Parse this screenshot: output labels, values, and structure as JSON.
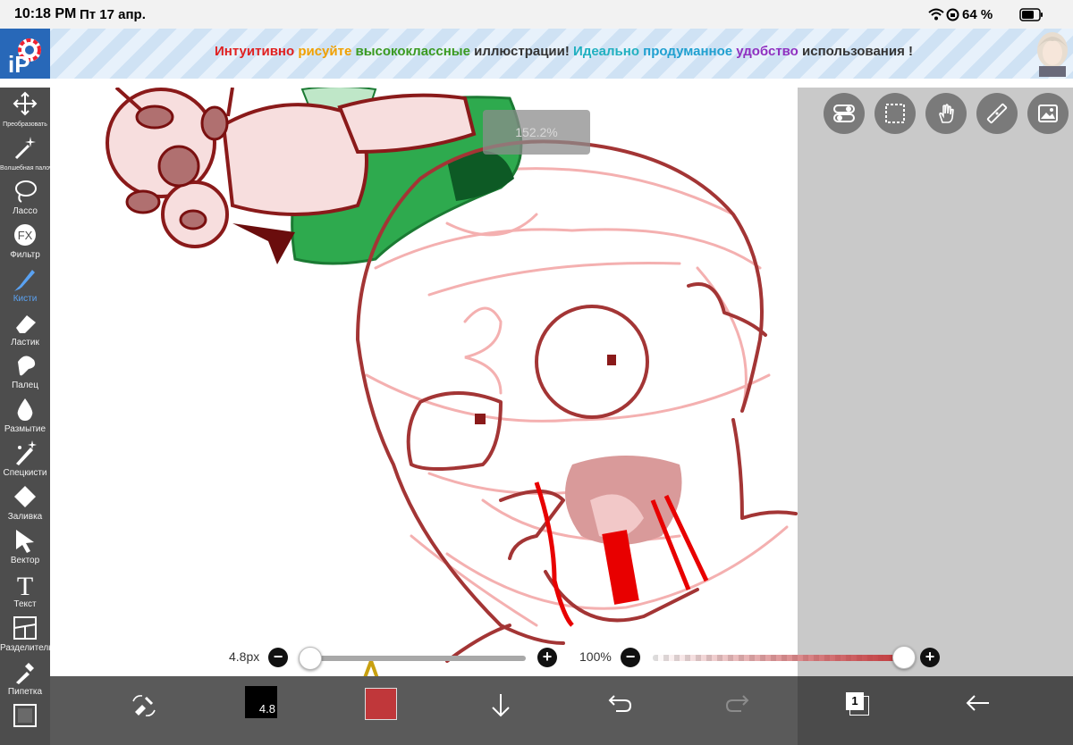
{
  "status_bar": {
    "time": "10:18 PM",
    "date": "Пт 17 апр.",
    "battery": "64 %",
    "icons": [
      "wifi-icon",
      "orientation-lock-icon",
      "battery-icon"
    ]
  },
  "banner": {
    "segments": [
      {
        "text": "Интуитивно ",
        "color": "#e02020"
      },
      {
        "text": "рисуйте ",
        "color": "#f0a000"
      },
      {
        "text": "высококлассные ",
        "color": "#3a9a20"
      },
      {
        "text": "иллюстрации! ",
        "color": "#333333"
      },
      {
        "text": "Идеально ",
        "color": "#20b0c0"
      },
      {
        "text": "продуманное ",
        "color": "#20a0d0"
      },
      {
        "text": "удобство ",
        "color": "#9030c0"
      },
      {
        "text": "использования !",
        "color": "#333333"
      }
    ]
  },
  "toolbar": {
    "tools": [
      {
        "id": "transform",
        "label": "Преобразовать",
        "icon": "move-arrows-icon",
        "small": true
      },
      {
        "id": "magic-wand",
        "label": "Волшебная палочка",
        "icon": "magic-wand-icon",
        "small": true
      },
      {
        "id": "lasso",
        "label": "Лассо",
        "icon": "lasso-icon"
      },
      {
        "id": "filter",
        "label": "Фильтр",
        "icon": "fx-icon",
        "glyph": "FX"
      },
      {
        "id": "brush",
        "label": "Кисти",
        "icon": "brush-icon",
        "active": true
      },
      {
        "id": "eraser",
        "label": "Ластик",
        "icon": "eraser-icon"
      },
      {
        "id": "finger",
        "label": "Палец",
        "icon": "finger-smudge-icon"
      },
      {
        "id": "blur",
        "label": "Размытие",
        "icon": "blur-drop-icon"
      },
      {
        "id": "special-brush",
        "label": "Спецкисти",
        "icon": "special-brush-icon"
      },
      {
        "id": "fill",
        "label": "Заливка",
        "icon": "fill-bucket-icon"
      },
      {
        "id": "vector",
        "label": "Вектор",
        "icon": "vector-arrow-icon"
      },
      {
        "id": "text",
        "label": "Текст",
        "icon": "text-t-icon",
        "glyph": "T"
      },
      {
        "id": "divider",
        "label": "Разделитель",
        "icon": "frame-divider-icon"
      },
      {
        "id": "eyedropper",
        "label": "Пипетка",
        "icon": "eyedropper-icon"
      },
      {
        "id": "canvas",
        "label": "",
        "icon": "canvas-icon"
      }
    ]
  },
  "canvas": {
    "zoom": "152.2%"
  },
  "quick_buttons": [
    "toggle-icon",
    "selection-icon",
    "hand-icon",
    "ruler-icon",
    "image-icon"
  ],
  "brush_size": {
    "value_label": "4.8px",
    "level": 0.0
  },
  "brush_opacity": {
    "value_label": "100%",
    "level": 1.0
  },
  "bottom_bar": {
    "brush_size_badge": "4.8",
    "color_swatch": "#c0373a",
    "layers_count": "1",
    "icons": [
      "brush-eraser-swap-icon",
      "brush-size-icon",
      "color-swatch-icon",
      "download-icon",
      "undo-icon",
      "redo-icon",
      "layers-icon",
      "back-arrow-icon"
    ]
  },
  "colors": {
    "toolbar_bg": "#4d4d4d",
    "bottom_bar_bg": "#5a5a5a",
    "active_tool": "#5aa2f2",
    "opacity_slider": "#c0373a"
  }
}
